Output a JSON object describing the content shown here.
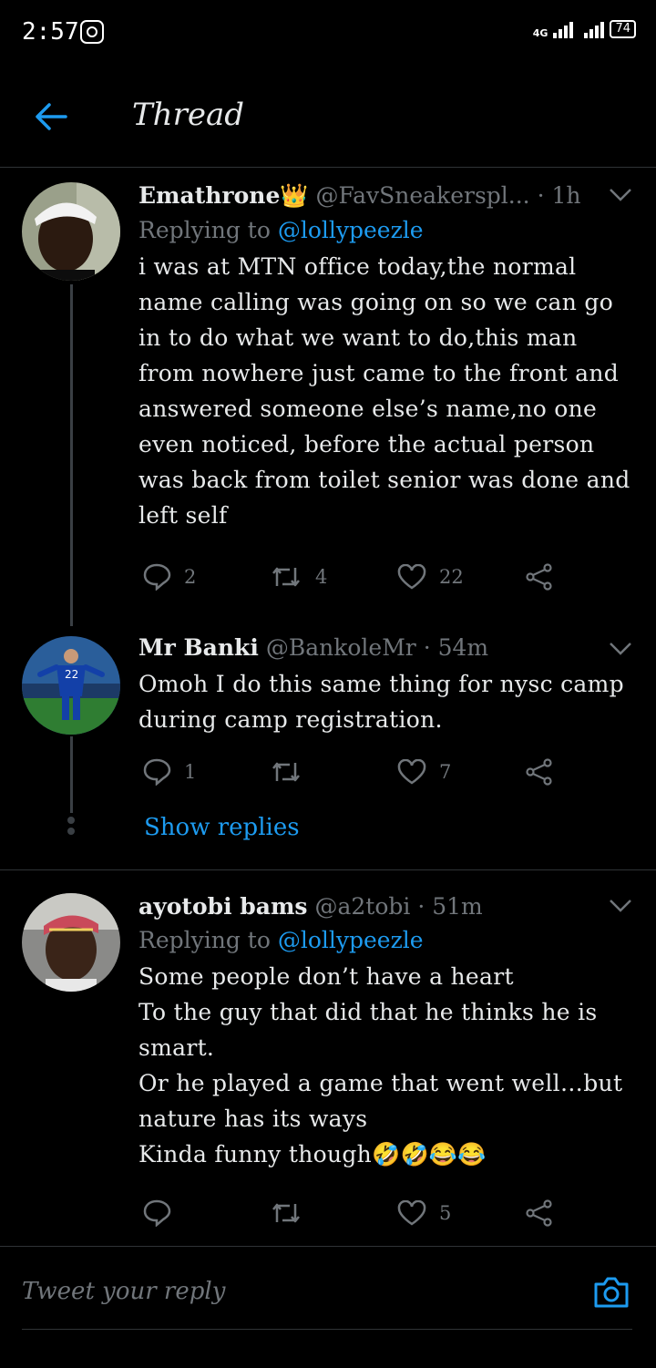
{
  "status": {
    "time": "2:57",
    "network": "4G",
    "battery": "74"
  },
  "header": {
    "title": "Thread"
  },
  "tweets": [
    {
      "name": "Emathrone👑",
      "handle": "@FavSneakerspl...",
      "time": "· 1h",
      "replying_prefix": "Replying to ",
      "replying_to": "@lollypeezle",
      "text": "i was at MTN office today,the normal name calling was going on so we can go in to do what we want to do,this man from nowhere just came to the front and answered someone else’s name,no one even noticed, before the actual person was back from toilet senior was done and left self",
      "replies": "2",
      "retweets": "4",
      "likes": "22"
    },
    {
      "name": "Mr Banki",
      "handle": "@BankoleMr",
      "time": "· 54m",
      "text": "Omoh I do this same thing for nysc camp during camp registration.",
      "replies": "1",
      "retweets": "",
      "likes": "7",
      "jersey_number": "22"
    },
    {
      "name": "ayotobi bams",
      "handle": "@a2tobi",
      "time": "· 51m",
      "replying_prefix": "Replying to ",
      "replying_to": "@lollypeezle",
      "text": "Some people don’t have a heart\nTo the guy that did that he thinks he is smart.\nOr he played a game that went well…but nature has its ways\nKinda funny though🤣🤣😂😂",
      "replies": "",
      "retweets": "",
      "likes": "5"
    }
  ],
  "show_replies": "Show replies",
  "reply_bar": {
    "placeholder": "Tweet your reply"
  },
  "colors": {
    "accent": "#1d9bf0",
    "muted": "#71767b",
    "background": "#000000"
  }
}
